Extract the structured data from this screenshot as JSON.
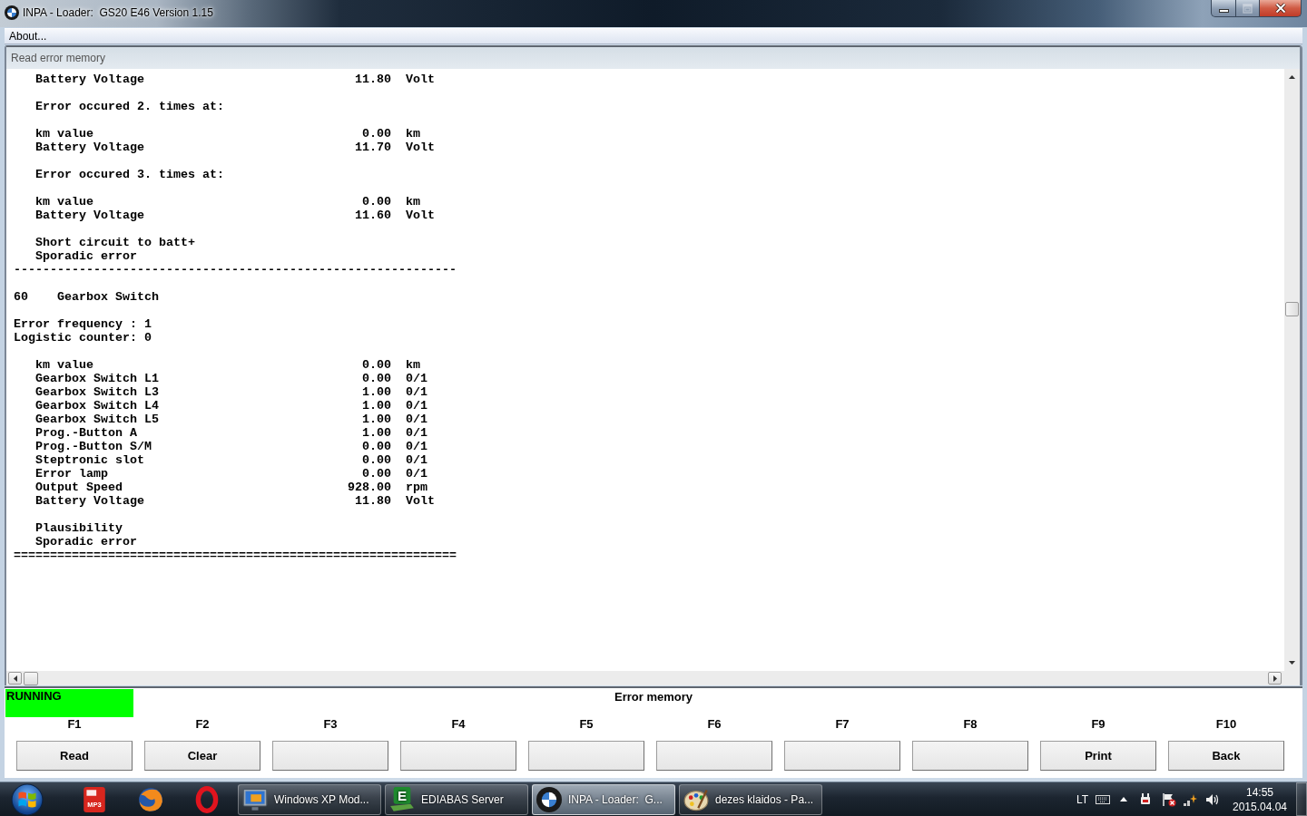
{
  "window": {
    "title": "INPA - Loader:  GS20 E46 Version 1.15",
    "restore_disabled": true
  },
  "menu": [
    {
      "label": "About..."
    }
  ],
  "panel": {
    "title": "Read error memory",
    "blocks": [
      {
        "lines": [
          {
            "kind": "measure",
            "label": "Battery Voltage",
            "value": "11.80",
            "unit": "Volt"
          }
        ]
      },
      {
        "lines": [
          {
            "kind": "note",
            "text": "Error occured 2. times at:"
          }
        ]
      },
      {
        "lines": [
          {
            "kind": "measure",
            "label": "km value",
            "value": "0.00",
            "unit": "km"
          },
          {
            "kind": "measure",
            "label": "Battery Voltage",
            "value": "11.70",
            "unit": "Volt"
          }
        ]
      },
      {
        "lines": [
          {
            "kind": "note",
            "text": "Error occured 3. times at:"
          }
        ]
      },
      {
        "lines": [
          {
            "kind": "measure",
            "label": "km value",
            "value": "0.00",
            "unit": "km"
          },
          {
            "kind": "measure",
            "label": "Battery Voltage",
            "value": "11.60",
            "unit": "Volt"
          }
        ]
      },
      {
        "lines": [
          {
            "kind": "note",
            "text": "Short circuit to batt+"
          },
          {
            "kind": "note",
            "text": "Sporadic error"
          },
          {
            "kind": "rule",
            "text": "-------------------------------------------------------------"
          }
        ]
      },
      {
        "lines": [
          {
            "kind": "heading",
            "code": "60",
            "text": "Gearbox Switch"
          }
        ]
      },
      {
        "lines": [
          {
            "kind": "plain",
            "text": "Error frequency : 1"
          },
          {
            "kind": "plain",
            "text": "Logistic counter: 0"
          }
        ]
      },
      {
        "lines": [
          {
            "kind": "measure",
            "label": "km value",
            "value": "0.00",
            "unit": "km"
          },
          {
            "kind": "measure",
            "label": "Gearbox Switch L1",
            "value": "0.00",
            "unit": "0/1"
          },
          {
            "kind": "measure",
            "label": "Gearbox Switch L3",
            "value": "1.00",
            "unit": "0/1"
          },
          {
            "kind": "measure",
            "label": "Gearbox Switch L4",
            "value": "1.00",
            "unit": "0/1"
          },
          {
            "kind": "measure",
            "label": "Gearbox Switch L5",
            "value": "1.00",
            "unit": "0/1"
          },
          {
            "kind": "measure",
            "label": "Prog.-Button A",
            "value": "1.00",
            "unit": "0/1"
          },
          {
            "kind": "measure",
            "label": "Prog.-Button S/M",
            "value": "0.00",
            "unit": "0/1"
          },
          {
            "kind": "measure",
            "label": "Steptronic slot",
            "value": "0.00",
            "unit": "0/1"
          },
          {
            "kind": "measure",
            "label": "Error lamp",
            "value": "0.00",
            "unit": "0/1"
          },
          {
            "kind": "measure",
            "label": "Output Speed",
            "value": "928.00",
            "unit": "rpm"
          },
          {
            "kind": "measure",
            "label": "Battery Voltage",
            "value": "11.80",
            "unit": "Volt"
          }
        ]
      },
      {
        "lines": [
          {
            "kind": "note",
            "text": "Plausibility"
          },
          {
            "kind": "note",
            "text": "Sporadic error"
          },
          {
            "kind": "rule",
            "text": "============================================================="
          }
        ]
      }
    ]
  },
  "status": {
    "label": "RUNNING",
    "running": true,
    "message": "Error memory"
  },
  "function_keys": [
    {
      "key": "F1",
      "label": "Read"
    },
    {
      "key": "F2",
      "label": "Clear"
    },
    {
      "key": "F3"
    },
    {
      "key": "F4"
    },
    {
      "key": "F5"
    },
    {
      "key": "F6"
    },
    {
      "key": "F7"
    },
    {
      "key": "F8"
    },
    {
      "key": "F9",
      "label": "Print"
    },
    {
      "key": "F10",
      "label": "Back"
    }
  ],
  "taskbar": {
    "pinned_file_label": "MP3",
    "tasks": [
      {
        "kind": "monitor",
        "label": "Windows XP Mod...",
        "selected": false
      },
      {
        "kind": "letter",
        "icon_letter": "E",
        "label": "EDIABAS Server",
        "selected": false
      },
      {
        "kind": "roundel",
        "label": "INPA - Loader:  G...",
        "selected": true
      },
      {
        "kind": "palette",
        "label": "dezes klaidos - Pa...",
        "selected": false
      }
    ],
    "tray": {
      "language": "LT",
      "time": "14:55",
      "date": "2015.04.04"
    }
  }
}
